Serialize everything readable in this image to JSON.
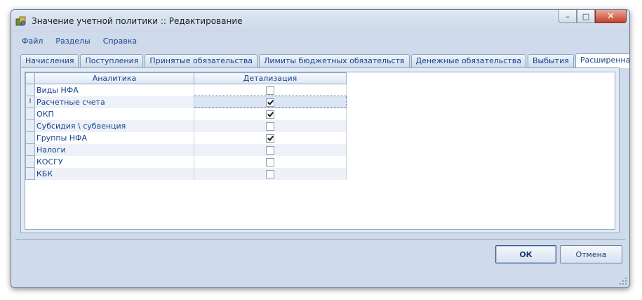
{
  "window": {
    "title": "Значение учетной политики :: Редактирование",
    "buttons": {
      "minimize": "–",
      "maximize": "□",
      "close": "✕"
    }
  },
  "menu": [
    "Файл",
    "Разделы",
    "Справка"
  ],
  "tabs": [
    {
      "label": "Начисления",
      "active": false
    },
    {
      "label": "Поступления",
      "active": false
    },
    {
      "label": "Принятые обязательства",
      "active": false
    },
    {
      "label": "Лимиты бюджетных обязательств",
      "active": false
    },
    {
      "label": "Денежные обязательства",
      "active": false
    },
    {
      "label": "Выбытия",
      "active": false
    },
    {
      "label": "Расширенная аналитика",
      "active": true
    }
  ],
  "grid": {
    "columns": [
      "Аналитика",
      "Детализация"
    ],
    "current_row_marker": "I",
    "rows": [
      {
        "name": "Виды НФА",
        "checked": false
      },
      {
        "name": "Расчетные счета",
        "checked": true
      },
      {
        "name": "ОКП",
        "checked": true
      },
      {
        "name": "Субсидия \\ субвенция",
        "checked": false
      },
      {
        "name": "Группы НФА",
        "checked": true
      },
      {
        "name": "Налоги",
        "checked": false
      },
      {
        "name": "КОСГУ",
        "checked": false
      },
      {
        "name": "КБК",
        "checked": false
      }
    ]
  },
  "footer": {
    "ok_label": "ОК",
    "cancel_label": "Отмена"
  },
  "colors": {
    "window_bg": "#cfdaea",
    "text_accent": "#15428b",
    "close_button": "#c5412b"
  }
}
